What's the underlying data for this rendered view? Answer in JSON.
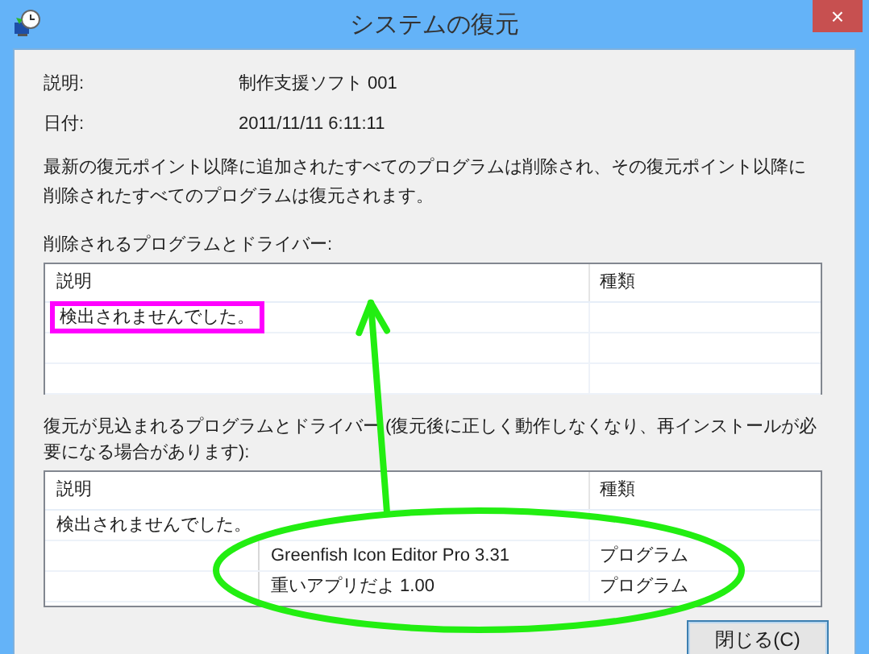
{
  "window": {
    "title": "システムの復元",
    "close": "×"
  },
  "details": [
    {
      "label": "説明:",
      "value": "制作支援ソフト 001"
    },
    {
      "label": "日付:",
      "value": "2011/11/11 6:11:11"
    }
  ],
  "message": "最新の復元ポイント以降に追加されたすべてのプログラムは削除され、その復元ポイント以降に削除されたすべてのプログラムは復元されます。",
  "sections": [
    {
      "label": "削除されるプログラムとドライバー:",
      "columns": [
        "説明",
        "種類"
      ],
      "rows": [
        {
          "kind": "plain",
          "description": "検出されませんでした。",
          "highlighted": true
        }
      ]
    },
    {
      "label": "復元が見込まれるプログラムとドライバー (復元後に正しく動作しなくなり、再インストールが必要になる場合があります):",
      "columns": [
        "説明",
        "種類"
      ],
      "rows": [
        {
          "kind": "plain",
          "description": "検出されませんでした。",
          "highlighted": false
        },
        {
          "kind": "inset",
          "description": "Greenfish Icon Editor Pro 3.31",
          "type": "プログラム",
          "highlighted": false
        },
        {
          "kind": "inset",
          "description": "重いアプリだよ 1.00",
          "type": "プログラム",
          "highlighted": false
        }
      ]
    }
  ],
  "buttons": [
    {
      "label": "閉じる(C)"
    }
  ]
}
